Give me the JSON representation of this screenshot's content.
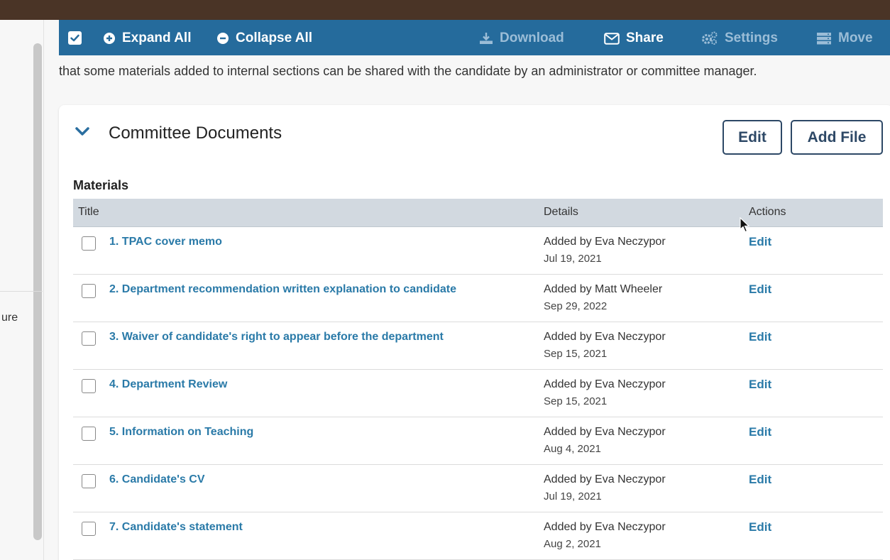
{
  "toolbar": {
    "expand_all": "Expand All",
    "collapse_all": "Collapse All",
    "download": "Download",
    "share": "Share",
    "settings": "Settings",
    "move": "Move",
    "icons": [
      "checkbox-checked-icon",
      "plus-circle-icon",
      "minus-circle-icon",
      "download-icon",
      "envelope-icon",
      "gears-icon",
      "server-icon"
    ]
  },
  "intro_text": "that some materials added to internal sections can be shared with the candidate by an administrator or committee manager.",
  "left_panel": {
    "clipped_text": "ure"
  },
  "section": {
    "title": "Committee Documents",
    "edit_label": "Edit",
    "add_file_label": "Add File",
    "materials_label": "Materials"
  },
  "table": {
    "headers": [
      "Title",
      "Details",
      "Actions"
    ],
    "rows": [
      {
        "title": "1. TPAC cover memo",
        "added_by": "Added by Eva Neczypor",
        "date": "Jul 19, 2021",
        "action": "Edit"
      },
      {
        "title": "2. Department recommendation written explanation to candidate",
        "added_by": "Added by Matt Wheeler",
        "date": "Sep 29, 2022",
        "action": "Edit"
      },
      {
        "title": "3. Waiver of candidate's right to appear before the department",
        "added_by": "Added by Eva Neczypor",
        "date": "Sep 15, 2021",
        "action": "Edit"
      },
      {
        "title": "4. Department Review",
        "added_by": "Added by Eva Neczypor",
        "date": "Sep 15, 2021",
        "action": "Edit"
      },
      {
        "title": "5. Information on Teaching",
        "added_by": "Added by Eva Neczypor",
        "date": "Aug 4, 2021",
        "action": "Edit"
      },
      {
        "title": "6. Candidate's CV",
        "added_by": "Added by Eva Neczypor",
        "date": "Jul 19, 2021",
        "action": "Edit"
      },
      {
        "title": "7. Candidate's statement",
        "added_by": "Added by Eva Neczypor",
        "date": "Aug 2, 2021",
        "action": "Edit"
      }
    ]
  },
  "colors": {
    "toolbar_bg": "#256b9c",
    "link": "#2a7aa8",
    "button_border": "#2d4866",
    "header_bg": "#d2d9e0",
    "topbar": "#4a3426"
  }
}
